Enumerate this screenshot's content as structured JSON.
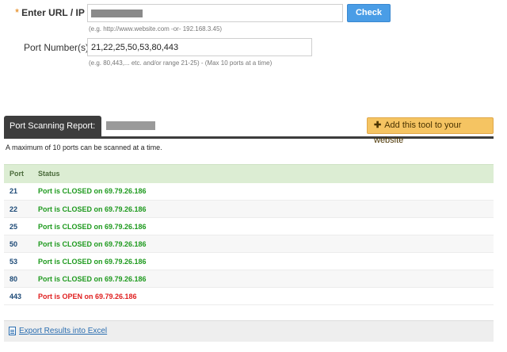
{
  "form": {
    "url_label": "Enter URL / IP",
    "url_required_mark": "*",
    "url_hint": "(e.g. http://www.website.com -or- 192.168.3.45)",
    "check_label": "Check",
    "port_label": "Port Number(s)",
    "port_value": "21,22,25,50,53,80,443",
    "port_hint": "(e.g. 80,443,... etc. and/or range 21-25) - (Max 10 ports at a time)"
  },
  "report": {
    "tab_label": "Port Scanning Report:",
    "add_tool_label": "Add this tool to your website",
    "note": "A maximum of 10 ports can be scanned at a time."
  },
  "table": {
    "headers": [
      "Port",
      "Status"
    ],
    "rows": [
      {
        "port": "21",
        "status": "Port is CLOSED on 69.79.26.186",
        "state": "closed"
      },
      {
        "port": "22",
        "status": "Port is CLOSED on 69.79.26.186",
        "state": "closed"
      },
      {
        "port": "25",
        "status": "Port is CLOSED on 69.79.26.186",
        "state": "closed"
      },
      {
        "port": "50",
        "status": "Port is CLOSED on 69.79.26.186",
        "state": "closed"
      },
      {
        "port": "53",
        "status": "Port is CLOSED on 69.79.26.186",
        "state": "closed"
      },
      {
        "port": "80",
        "status": "Port is CLOSED on 69.79.26.186",
        "state": "closed"
      },
      {
        "port": "443",
        "status": "Port is OPEN on 69.79.26.186",
        "state": "open"
      }
    ]
  },
  "export": {
    "label": "Export Results into Excel"
  },
  "colors": {
    "check_button": "#4a9de6",
    "closed_status": "#1e9a1e",
    "open_status": "#e02020",
    "add_tool_button": "#f5c462",
    "header_row": "#dcedd3"
  },
  "icons": {
    "export": "document-icon",
    "add_tool": "plus-icon"
  }
}
